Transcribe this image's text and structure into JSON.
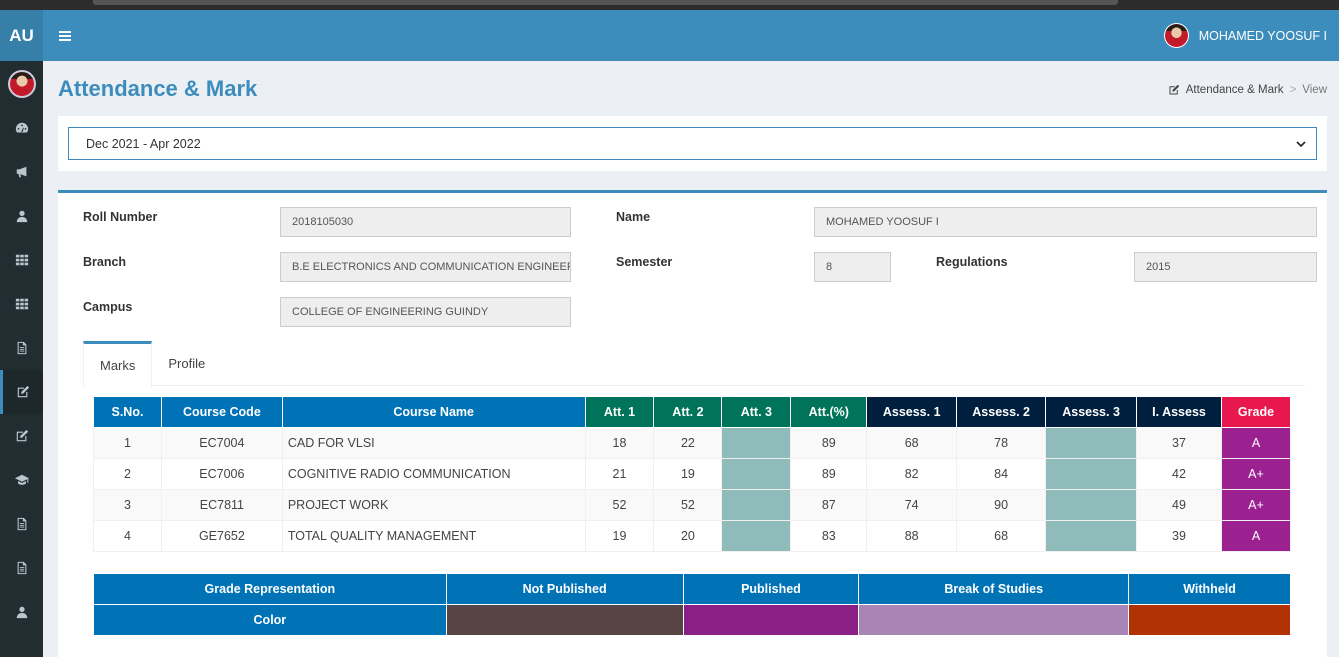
{
  "app": {
    "logo": "AU"
  },
  "header": {
    "user_name": "MOHAMED YOOSUF I"
  },
  "sidebar": {
    "items": [
      {
        "icon": "dashboard-icon"
      },
      {
        "icon": "megaphone-icon"
      },
      {
        "icon": "user-icon"
      },
      {
        "icon": "grid-icon"
      },
      {
        "icon": "grid-icon"
      },
      {
        "icon": "document-icon"
      },
      {
        "icon": "edit-icon"
      },
      {
        "icon": "edit-icon"
      },
      {
        "icon": "graduation-cap-icon"
      },
      {
        "icon": "document-icon"
      },
      {
        "icon": "document-icon"
      },
      {
        "icon": "user-icon"
      }
    ]
  },
  "page": {
    "title": "Attendance & Mark"
  },
  "breadcrumb": {
    "item1": "Attendance & Mark",
    "separator": ">",
    "current": "View"
  },
  "session": {
    "selected": "Dec 2021 - Apr 2022"
  },
  "student": {
    "roll_label": "Roll Number",
    "roll": "2018105030",
    "name_label": "Name",
    "name": "MOHAMED YOOSUF I",
    "branch_label": "Branch",
    "branch": "B.E ELECTRONICS AND COMMUNICATION ENGINEERING",
    "semester_label": "Semester",
    "semester": "8",
    "regulations_label": "Regulations",
    "regulations": "2015",
    "campus_label": "Campus",
    "campus": "COLLEGE OF ENGINEERING GUINDY"
  },
  "tabs": {
    "marks": "Marks",
    "profile": "Profile"
  },
  "marks_table": {
    "headers": [
      "S.No.",
      "Course Code",
      "Course Name",
      "Att. 1",
      "Att. 2",
      "Att. 3",
      "Att.(%)",
      "Assess. 1",
      "Assess. 2",
      "Assess. 3",
      "I. Assess",
      "Grade"
    ],
    "rows": [
      {
        "sno": "1",
        "code": "EC7004",
        "name": "CAD FOR VLSI",
        "att1": "18",
        "att2": "22",
        "att3": "",
        "attp": "89",
        "as1": "68",
        "as2": "78",
        "as3": "",
        "ia": "37",
        "grade": "A"
      },
      {
        "sno": "2",
        "code": "EC7006",
        "name": "COGNITIVE RADIO COMMUNICATION",
        "att1": "21",
        "att2": "19",
        "att3": "",
        "attp": "89",
        "as1": "82",
        "as2": "84",
        "as3": "",
        "ia": "42",
        "grade": "A+"
      },
      {
        "sno": "3",
        "code": "EC7811",
        "name": "PROJECT WORK",
        "att1": "52",
        "att2": "52",
        "att3": "",
        "attp": "87",
        "as1": "74",
        "as2": "90",
        "as3": "",
        "ia": "49",
        "grade": "A+"
      },
      {
        "sno": "4",
        "code": "GE7652",
        "name": "TOTAL QUALITY MANAGEMENT",
        "att1": "19",
        "att2": "20",
        "att3": "",
        "attp": "83",
        "as1": "88",
        "as2": "68",
        "as3": "",
        "ia": "39",
        "grade": "A"
      }
    ]
  },
  "legend": {
    "grade_rep": "Grade Representation",
    "not_published": "Not Published",
    "published": "Published",
    "break_of_studies": "Break of Studies",
    "withheld": "Withheld",
    "color": "Color",
    "colors": {
      "not_published": "#574444",
      "published": "#8a1f86",
      "break_of_studies": "#a985b5",
      "withheld": "#b03205"
    }
  },
  "colors": {
    "primary": "#3c8dbc",
    "blue": "#0073b7",
    "green": "#00745a",
    "navy": "#001f3f",
    "red": "#e8174e",
    "teal": "#8fbcbb",
    "grade": "#9b2191"
  }
}
